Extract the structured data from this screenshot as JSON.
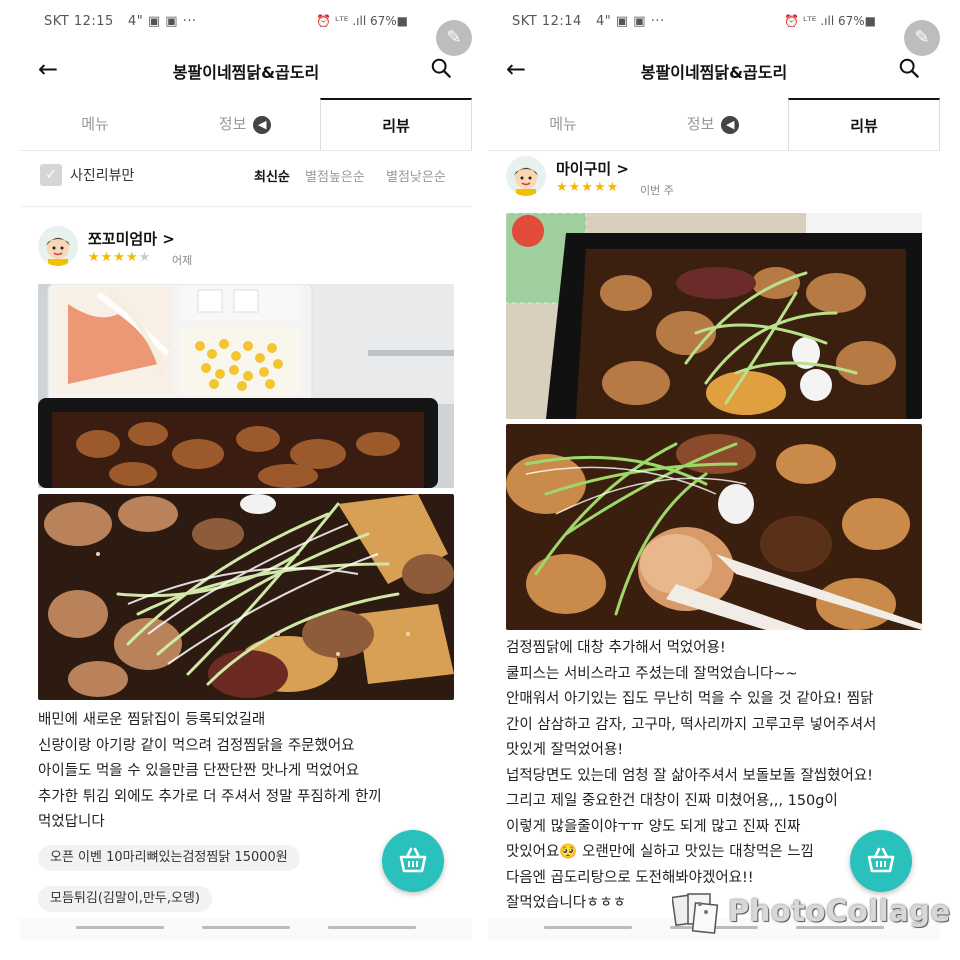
{
  "brand_color": "#2ac1bc",
  "star_color": "#f5b700",
  "left": {
    "status": {
      "time": "SKT 12:15",
      "indicators": "4\" ▣ ▣ ···",
      "sys": "⏰ ᴸᵀᴱ .ıll 67%■"
    },
    "header": {
      "title": "봉팔이네찜닭&곱도리",
      "back_icon": "arrow-left",
      "search_icon": "search"
    },
    "tabs": [
      {
        "label": "메뉴"
      },
      {
        "label": "정보",
        "badge": "◀"
      },
      {
        "label": "리뷰",
        "active": true
      }
    ],
    "filter": {
      "checkbox_label": "사진리뷰만",
      "sort": [
        "최신순",
        "별점높은순",
        "별점낮은순"
      ],
      "selected_sort": "최신순"
    },
    "review": {
      "user": "쪼꼬미엄마 >",
      "rating": 4,
      "date": "어제",
      "lines": [
        "배민에 새로운 찜닭집이 등록되었길래",
        "신랑이랑 아기랑 같이 먹으려 검정찜닭을 주문했어요",
        "아이들도 먹을 수 있을만큼 단짠단짠 맛나게 먹었어요",
        "추가한 튀김 외에도 추가로 더 주셔서 정말 푸짐하게 한끼",
        "먹었답니다"
      ],
      "chips": [
        "오픈 이벤 10마리뼈있는검정찜닭 15000원",
        "모듬튀김(김말이,만두,오뎅)"
      ]
    }
  },
  "right": {
    "status": {
      "time": "SKT 12:14",
      "indicators": "4\" ▣ ▣ ···",
      "sys": "⏰ ᴸᵀᴱ .ıll 67%■"
    },
    "header": {
      "title": "봉팔이네찜닭&곱도리",
      "back_icon": "arrow-left",
      "search_icon": "search"
    },
    "tabs": [
      {
        "label": "메뉴"
      },
      {
        "label": "정보",
        "badge": "◀"
      },
      {
        "label": "리뷰",
        "active": true
      }
    ],
    "review": {
      "user": "마이구미 >",
      "rating": 5,
      "date": "이번 주",
      "lines": [
        "검정찜닭에 대창 추가해서 먹었어용!",
        "쿨피스는 서비스라고 주셨는데 잘먹었습니다~~",
        "안매워서 아기있는 집도 무난히 먹을 수 있을 것 같아요! 찜닭",
        "간이 삼삼하고 감자, 고구마, 떡사리까지 고루고루 넣어주셔서",
        "맛있게 잘먹었어용!",
        "넙적당면도 있는데 엄청 잘 삶아주셔서 보돌보돌 잘씹혔어요!",
        "그리고 제일 중요한건 대창이 진짜 미쳤어용,,, 150g이",
        "이렇게 많을줄이야ㅜㅠ 양도 되게 많고 진짜 진짜",
        "맛있어요🥺 오랜만에 실하고 맛있는 대창먹은 느낌",
        "다음엔 곱도리탕으로 도전해봐야겠어요!!",
        "잘먹었습니다ㅎㅎㅎ"
      ]
    }
  },
  "watermark": {
    "text": "PhotoCollage"
  }
}
